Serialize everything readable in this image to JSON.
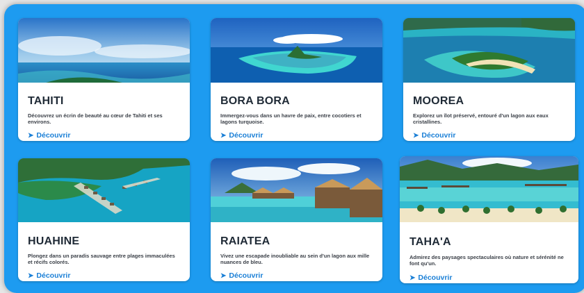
{
  "cards": [
    {
      "title": "TAHITI",
      "description": "Découvrez un écrin de beauté au cœur de Tahiti et ses environs.",
      "link_label": "Découvrir",
      "link_icon": "arrow-right-icon"
    },
    {
      "title": "BORA BORA",
      "description": "Immergez-vous dans un havre de paix, entre cocotiers et lagons turquoise.",
      "link_label": "Découvrir",
      "link_icon": "arrow-right-icon"
    },
    {
      "title": "MOOREA",
      "description": "Explorez un îlot préservé, entouré d'un lagon aux eaux cristallines.",
      "link_label": "Découvrir",
      "link_icon": "arrow-right-icon"
    },
    {
      "title": "HUAHINE",
      "description": "Plongez dans un paradis sauvage entre plages immaculées et récifs colorés.",
      "link_label": "Découvrir",
      "link_icon": "arrow-right-icon"
    },
    {
      "title": "RAIATEA",
      "description": "Vivez une escapade inoubliable au sein d'un lagon aux mille nuances de bleu.",
      "link_label": "Découvrir",
      "link_icon": "arrow-right-icon"
    },
    {
      "title": "TAHA'A",
      "description": "Admirez des paysages spectaculaires où nature et sérénité ne font qu'un.",
      "link_label": "Découvrir",
      "link_icon": "arrow-right-icon"
    }
  ],
  "colors": {
    "background": "#1d9bf0",
    "card": "#ffffff",
    "title": "#1f2a36",
    "link": "#1a7fd6"
  }
}
